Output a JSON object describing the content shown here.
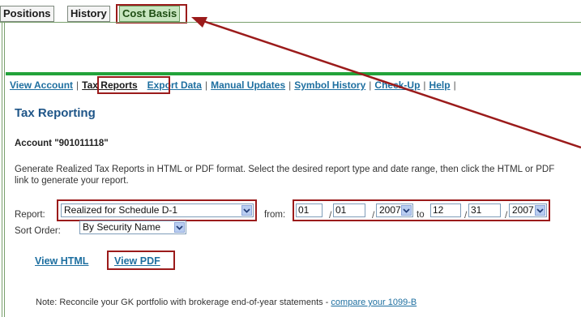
{
  "tabs": [
    "Positions",
    "History",
    "Cost Basis"
  ],
  "subnav": [
    "View Account",
    "Tax Reports",
    "Export Data",
    "Manual Updates",
    "Symbol History",
    "Check-Up",
    "Help"
  ],
  "subnav_sep": "|",
  "page": {
    "title": "Tax Reporting",
    "account": "Account \"901011118\"",
    "description": "Generate Realized Tax Reports in HTML or PDF format. Select the desired report type and date range, then click the HTML or PDF link to generate your report."
  },
  "form": {
    "report_label": "Report:",
    "report_value": "Realized for Schedule D-1",
    "from_label": "from:",
    "to_label": "to",
    "date_sep": "/",
    "from_month": "01",
    "from_day": "01",
    "from_year": "2007",
    "to_month": "12",
    "to_day": "31",
    "to_year": "2007",
    "sort_label": "Sort Order:",
    "sort_value": "By Security Name"
  },
  "links": {
    "view_html": "View HTML",
    "view_pdf": "View PDF"
  },
  "note": {
    "prefix": "Note:",
    "text": "Reconcile your GK portfolio with brokerage end-of-year statements -",
    "link": "compare your 1099-B"
  },
  "colors": {
    "highlight": "#9b1b1b",
    "green_bar": "#22a33a",
    "link": "#1e6fa0",
    "title": "#1e5588"
  },
  "icons": {
    "dropdown": "chevron-down-icon",
    "arrow": "annotation-arrow"
  }
}
